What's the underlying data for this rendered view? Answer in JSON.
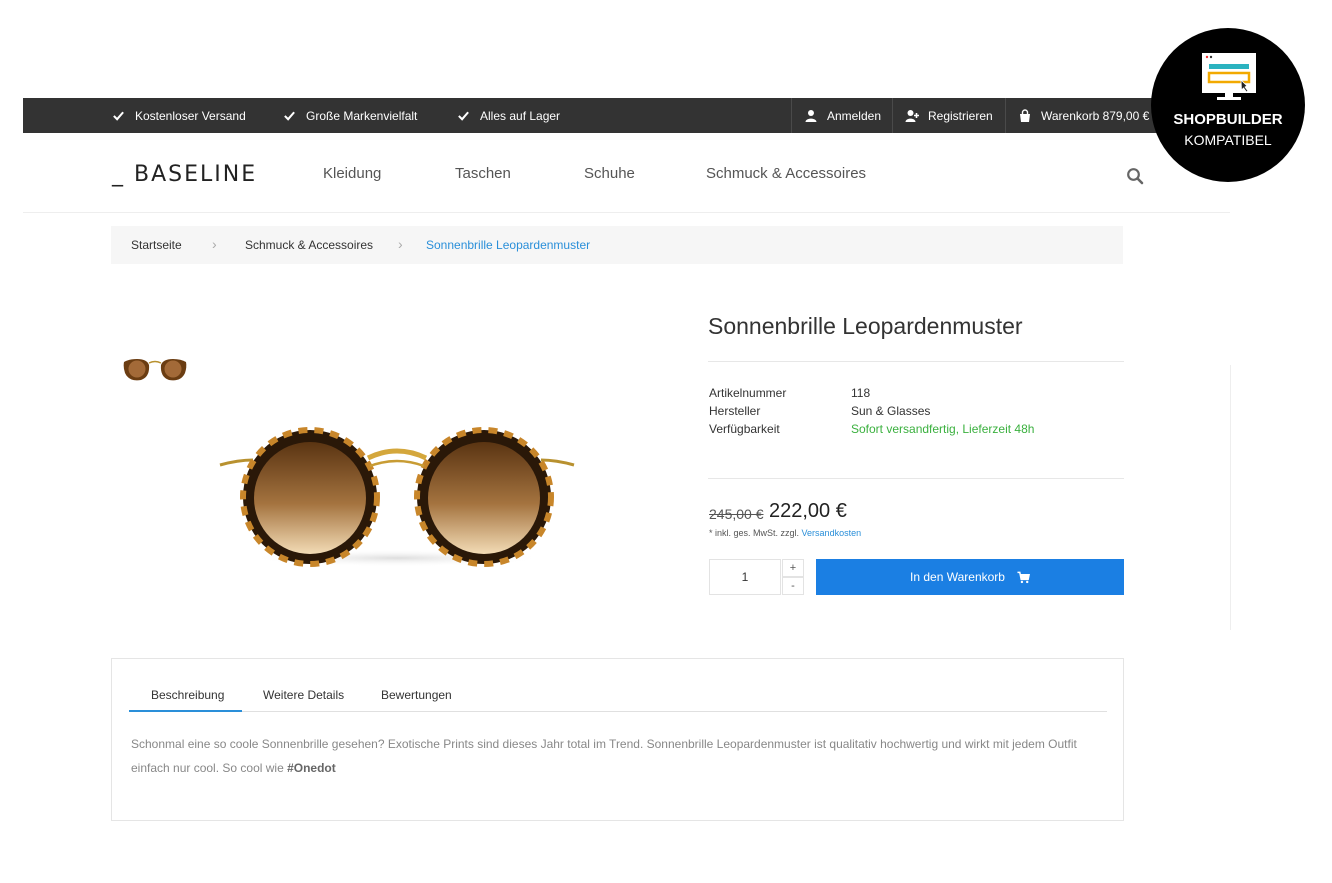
{
  "topbar": {
    "usps": [
      "Kostenloser Versand",
      "Große Markenvielfalt",
      "Alles auf Lager"
    ],
    "login": "Anmelden",
    "register": "Registrieren",
    "cart": "Warenkorb 879,00 €"
  },
  "header": {
    "logo": "_ BASELINE",
    "nav": [
      "Kleidung",
      "Taschen",
      "Schuhe",
      "Schmuck & Accessoires"
    ]
  },
  "breadcrumb": [
    "Startseite",
    "Schmuck & Accessoires",
    "Sonnenbrille Leopardenmuster"
  ],
  "product": {
    "title": "Sonnenbrille Leopardenmuster",
    "properties": [
      {
        "label": "Artikelnummer",
        "value": "118"
      },
      {
        "label": "Hersteller",
        "value": "Sun & Glasses"
      },
      {
        "label": "Verfügbarkeit",
        "value": "Sofort versandfertig, Lieferzeit 48h"
      }
    ],
    "old_price": "245,00 €",
    "price": "222,00 €",
    "tax_note": "* inkl. ges. MwSt. zzgl.",
    "shipping_link": "Versandkosten",
    "quantity": "1",
    "qty_plus": "+",
    "qty_minus": "-",
    "add_to_cart": "In den Warenkorb"
  },
  "tabs": {
    "items": [
      "Beschreibung",
      "Weitere Details",
      "Bewertungen"
    ],
    "active": 0,
    "description": "Schonmal eine so coole Sonnenbrille gesehen? Exotische Prints sind dieses Jahr total im Trend. Sonnenbrille Leopardenmuster ist qualitativ hochwertig und wirkt mit jedem Outfit einfach nur cool. So cool wie ",
    "description_tag": "#Onedot"
  },
  "badge": {
    "line1": "SHOPBUILDER",
    "line2": "KOMPATIBEL"
  },
  "colors": {
    "topbar": "#333333",
    "accent": "#1b7fe3",
    "link": "#2a8fd9",
    "available": "#3ab03e"
  }
}
